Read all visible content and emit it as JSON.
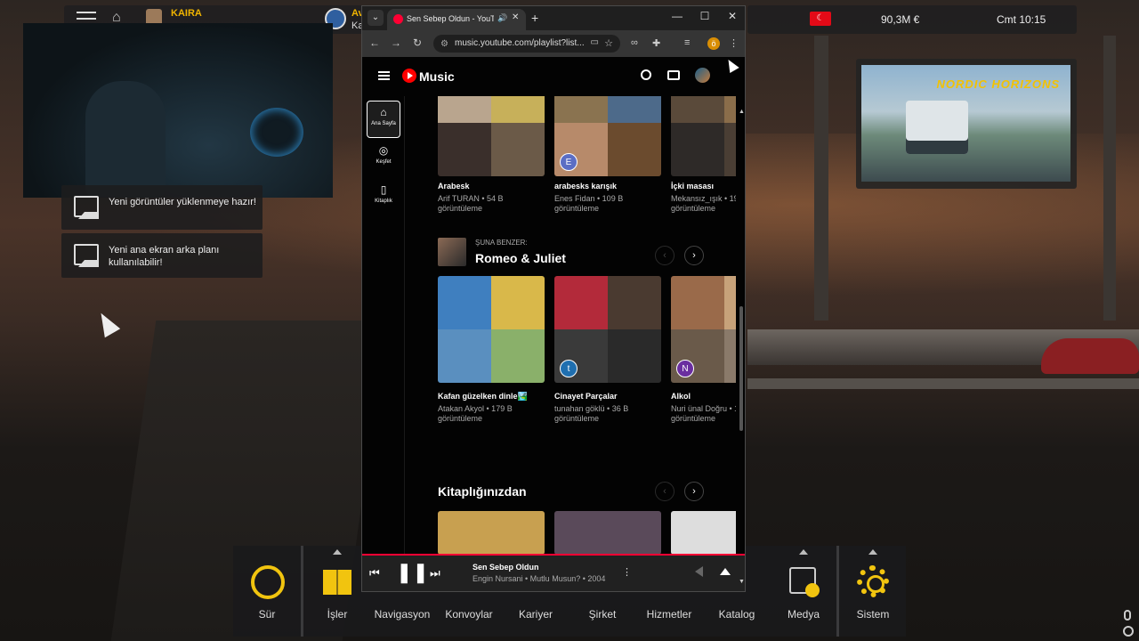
{
  "game_hud": {
    "player_name": "KAIRA",
    "company_name": "Av",
    "company_sub": "Ka",
    "flag_label": "☾",
    "money": "90,3M €",
    "clock": "Cmt 10:15"
  },
  "notifications": [
    {
      "text": "Yeni görüntüler yüklenmeye hazır!"
    },
    {
      "text": "Yeni ana ekran arka planı kullanılabilir!"
    }
  ],
  "billboard": {
    "brand": "NORDIC HORIZONS"
  },
  "dock": {
    "items": [
      {
        "label": "Sür"
      },
      {
        "label": "İşler"
      },
      {
        "label": "Navigasyon"
      },
      {
        "label": "Konvoylar"
      },
      {
        "label": "Kariyer"
      },
      {
        "label": "Şirket"
      },
      {
        "label": "Hizmetler"
      },
      {
        "label": "Katalog"
      },
      {
        "label": "Medya"
      },
      {
        "label": "Sistem"
      }
    ]
  },
  "browser": {
    "tab_title": "Sen Sebep Oldun - YouTube",
    "url": "music.youtube.com/playlist?list...",
    "profile_initial": "ö",
    "newtab": "+",
    "min": "—",
    "max": "☐",
    "close": "✕"
  },
  "ytm": {
    "brand": "Music",
    "sidebar": [
      {
        "label": "Ana Sayfa"
      },
      {
        "label": "Keşfet"
      },
      {
        "label": "Kitaplık"
      }
    ],
    "row1": [
      {
        "title": "Arabesk",
        "line1": "Arif TURAN • 54 B",
        "line2": "görüntüleme",
        "badge": ""
      },
      {
        "title": "arabesks karışık",
        "line1": "Enes Fidan • 109 B",
        "line2": "görüntüleme",
        "badge": "E"
      },
      {
        "title": "İçki masası",
        "line1": "Mekansız_ışık • 19",
        "line2": "görüntüleme",
        "badge": ""
      }
    ],
    "section2": {
      "kicker": "ŞUNA BENZER:",
      "title": "Romeo & Juliet",
      "cards": [
        {
          "title": "Kafan güzelken dinle🏞️",
          "line1": "Atakan Akyol • 179 B",
          "line2": "görüntüleme",
          "badge": ""
        },
        {
          "title": "Cinayet Parçalar",
          "line1": "tunahan göklü • 36 B",
          "line2": "görüntüleme",
          "badge": "t"
        },
        {
          "title": "Alkol",
          "line1": "Nuri ünal Doğru • 1",
          "line2": "görüntüleme",
          "badge": "N"
        }
      ]
    },
    "section3": {
      "title": "Kitaplığınızdan"
    },
    "now_playing": {
      "title": "Sen Sebep Oldun",
      "subtitle": "Engin Nursani • Mutlu Musun? • 2004"
    }
  }
}
